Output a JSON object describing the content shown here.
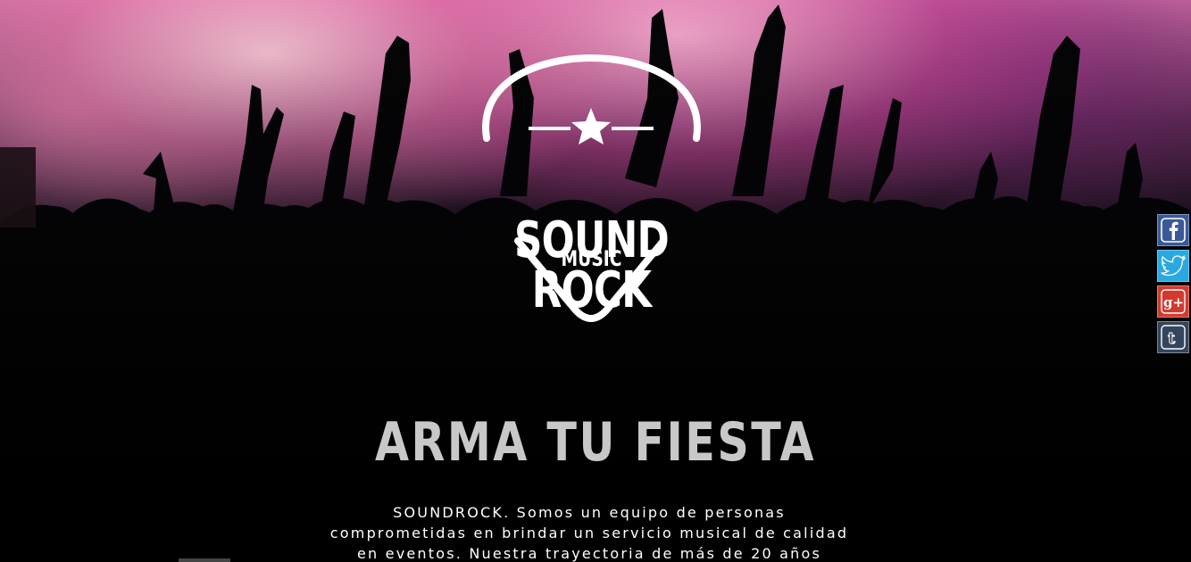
{
  "brand": {
    "name": "SOUND ROCK",
    "tagline": "MUSIC"
  },
  "headline": "ARMA TU FIESTA",
  "intro": {
    "line1": "SOUNDROCK. Somos un equipo de personas",
    "line2": "comprometidas en brindar un servicio musical de calidad",
    "line3": "en eventos. Nuestra trayectoria de más de 20 años"
  },
  "social": [
    {
      "icon": "facebook-icon",
      "color": "#3b5998"
    },
    {
      "icon": "twitter-icon",
      "color": "#2aa9e0"
    },
    {
      "icon": "google-plus-icon",
      "color": "#d23a2e"
    },
    {
      "icon": "tumblr-icon",
      "color": "#34465d"
    }
  ]
}
